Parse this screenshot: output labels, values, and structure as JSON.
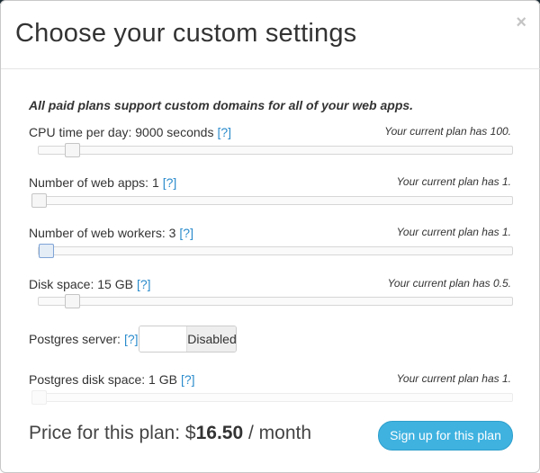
{
  "dialog": {
    "title": "Choose your custom settings",
    "close_glyph": "×"
  },
  "note": "All paid plans support custom domains for all of your web apps.",
  "help_text": "[?]",
  "settings": {
    "cpu": {
      "label": "CPU time per day: 9000 seconds",
      "current": "Your current plan has 100.",
      "level": 0.07
    },
    "web_apps": {
      "label": "Number of web apps: 1",
      "current": "Your current plan has 1.",
      "level": 0.0
    },
    "web_workers": {
      "label": "Number of web workers: 3",
      "current": "Your current plan has 1.",
      "level": 0.015
    },
    "disk": {
      "label": "Disk space: 15 GB",
      "current": "Your current plan has 0.5.",
      "level": 0.07
    },
    "postgres": {
      "label": "Postgres server:",
      "toggle_state": "Disabled"
    },
    "postgres_disk": {
      "label": "Postgres disk space: 1 GB",
      "current": "Your current plan has 1.",
      "level": 0.0
    }
  },
  "price": {
    "prefix": "Price for this plan: $",
    "amount": "16.50",
    "suffix": " / month"
  },
  "signup_label": "Sign up for this plan",
  "colors": {
    "accent_button": "#3fb2e0",
    "help_link": "#2a8bcc",
    "top_bar": "#0b4a5c"
  }
}
